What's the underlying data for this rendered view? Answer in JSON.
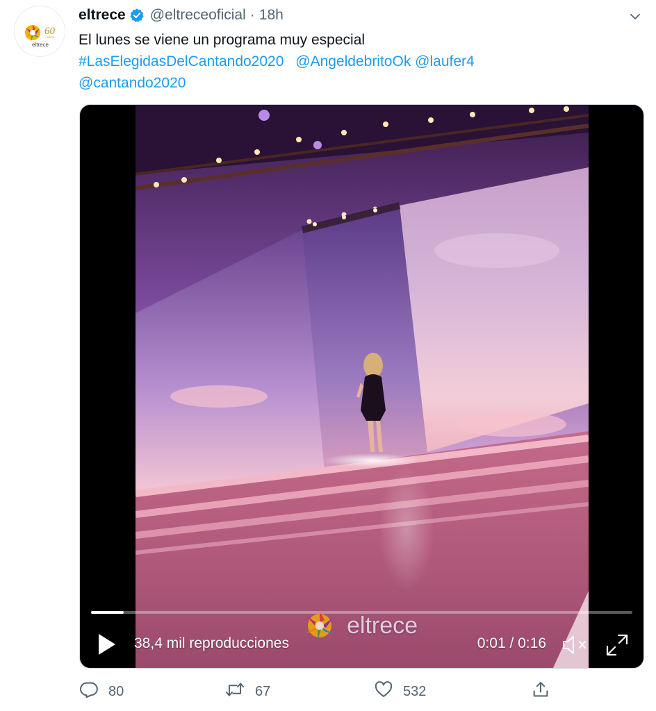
{
  "tweet": {
    "display_name": "eltrece",
    "handle": "@eltreceoficial",
    "separator": "·",
    "time": "18h",
    "text_line1": "El lunes se viene un programa muy especial",
    "hashtag": "#LasElegidasDelCantando2020",
    "mention1": "@AngeldebritoOk",
    "mention2": "@laufer4",
    "mention3": "@cantando2020"
  },
  "avatar": {
    "logo_name": "eltrece",
    "anniversary": "60",
    "anniversary_label": "AÑOS"
  },
  "video": {
    "views": "38,4 mil reproducciones",
    "timecode": "0:01 / 0:16",
    "progress_fraction": 0.06,
    "watermark": "eltrece"
  },
  "actions": {
    "replies": "80",
    "retweets": "67",
    "likes": "532"
  },
  "colors": {
    "link": "#1d9bf0",
    "verified": "#1d9bf0",
    "muted_text": "#536471"
  },
  "icons": {
    "verified": "verified-badge-icon",
    "caret": "chevron-down-icon",
    "play": "play-icon",
    "mute": "volume-muted-icon",
    "fullscreen": "fullscreen-icon",
    "reply": "reply-icon",
    "retweet": "retweet-icon",
    "like": "heart-icon",
    "share": "share-icon"
  }
}
